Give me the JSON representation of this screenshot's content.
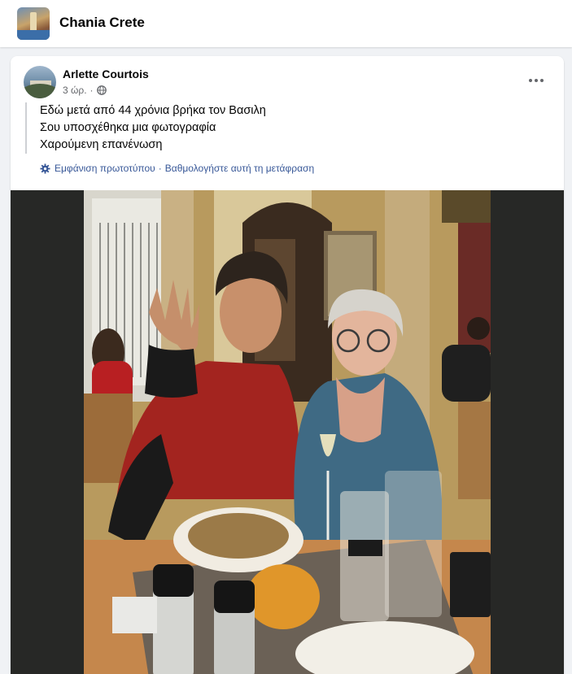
{
  "group": {
    "name": "Chania Crete"
  },
  "post": {
    "author": "Arlette Courtois",
    "time": "3 ώρ.",
    "lines": [
      "Εδώ μετά από 44 χρόνια βρήκα τον Βασιλη",
      "Σου υποσχέθηκα μια φωτογραφία",
      "Χαρούμενη επανένωση"
    ],
    "translation": {
      "show_original": "Εμφάνιση πρωτοτύπου",
      "separator": "·",
      "rate": "Βαθμολογήστε αυτή τη μετάφραση"
    }
  },
  "icons": {
    "globe": "globe-icon",
    "gear": "gear-icon",
    "more": "more-options-icon"
  },
  "colors": {
    "link": "#385898",
    "secondary_text": "#65676b",
    "page_bg": "#f0f2f5",
    "photo_bg": "#272826"
  }
}
